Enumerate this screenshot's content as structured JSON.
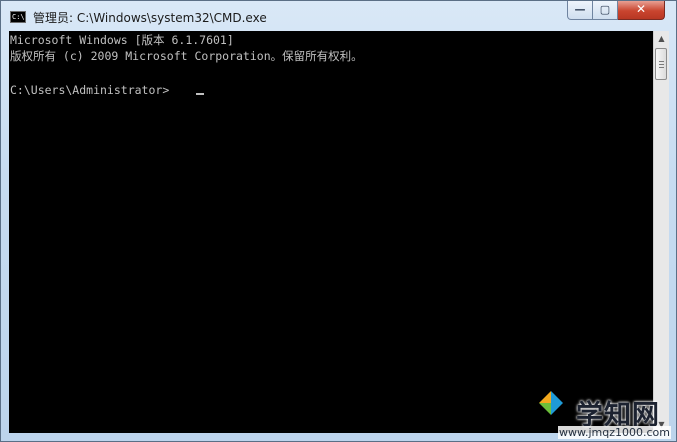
{
  "window": {
    "title": "管理员: C:\\Windows\\system32\\CMD.exe",
    "app_icon_text": "C:\\",
    "minimize_glyph": "—",
    "maximize_glyph": "▢",
    "close_glyph": "✕"
  },
  "console": {
    "lines": [
      "Microsoft Windows [版本 6.1.7601]",
      "版权所有 (c) 2009 Microsoft Corporation。保留所有权利。",
      "C:\\Users\\Administrator>"
    ],
    "background": "#000000",
    "foreground": "#c0c0c0"
  },
  "scrollbar": {
    "up_glyph": "▲",
    "down_glyph": "▼"
  },
  "watermark": {
    "text": "学知网",
    "url": "www.jmqz1000.com"
  },
  "colors": {
    "close_button": "#c9452f",
    "titlebar": "#c7dcf1"
  }
}
